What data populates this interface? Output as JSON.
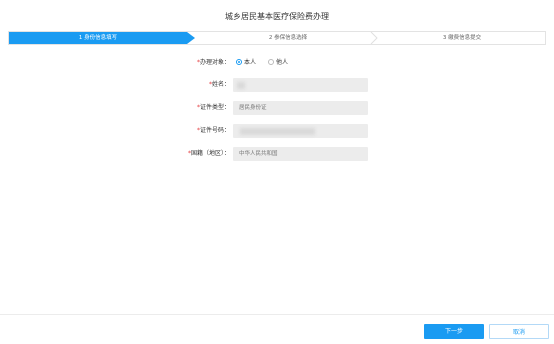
{
  "page": {
    "title": "城乡居民基本医疗保险费办理"
  },
  "steps": [
    {
      "label": "1 身份信息填写"
    },
    {
      "label": "2 参保信息选择"
    },
    {
      "label": "3 缴费信息提交"
    }
  ],
  "form": {
    "handler": {
      "label": "办理对象：",
      "options": [
        "本人",
        "他人"
      ],
      "selected": "本人"
    },
    "name": {
      "label": "姓名：",
      "value": ""
    },
    "id_type": {
      "label": "证件类型：",
      "value": "居民身份证"
    },
    "id_number": {
      "label": "证件号码：",
      "value": ""
    },
    "nationality": {
      "label": "国籍（地区）：",
      "value": "中华人民共和国"
    }
  },
  "footer": {
    "next_label": "下一步",
    "cancel_label": "取消"
  },
  "colors": {
    "accent": "#1a9bf2",
    "required": "#e4393c",
    "field_bg": "#ececec"
  }
}
